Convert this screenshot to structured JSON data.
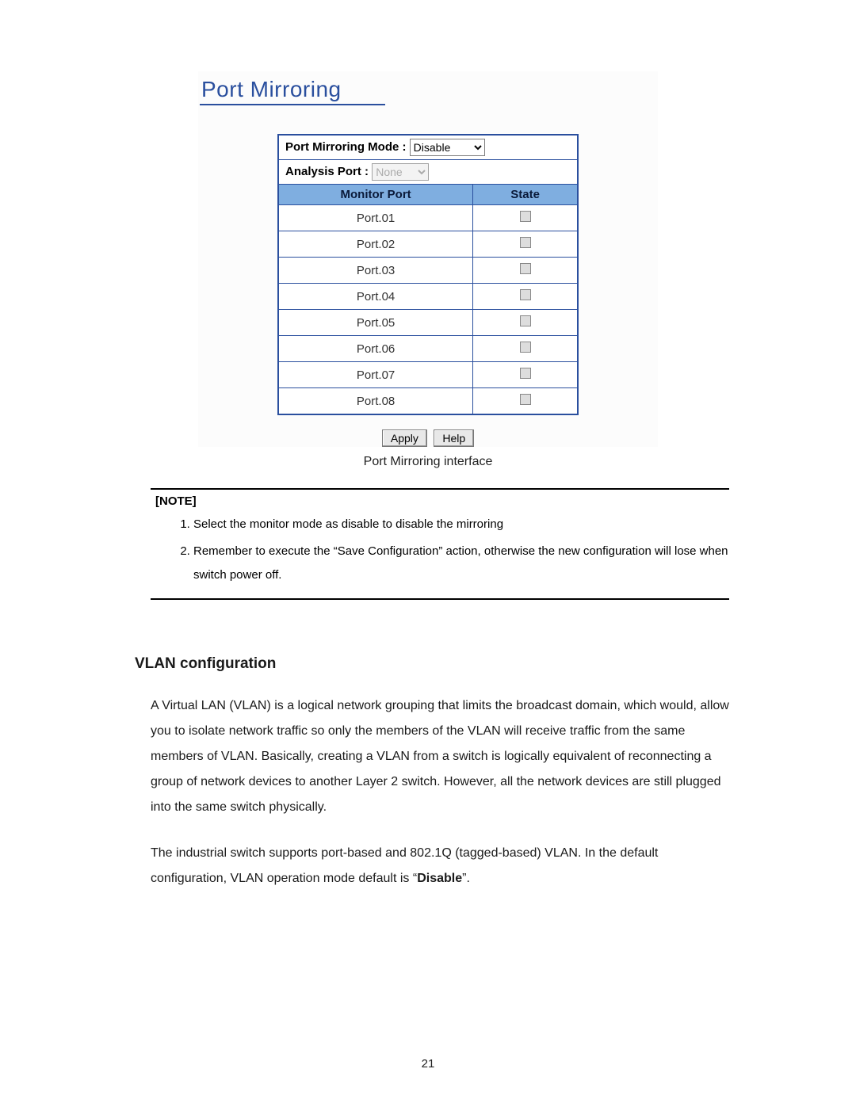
{
  "ui": {
    "title": "Port Mirroring",
    "mode_label": "Port Mirroring Mode : ",
    "mode_value": "Disable",
    "analysis_label": "Analysis Port : ",
    "analysis_value": "None",
    "col_monitor": "Monitor Port",
    "col_state": "State",
    "ports": [
      {
        "name": "Port.01",
        "checked": false
      },
      {
        "name": "Port.02",
        "checked": false
      },
      {
        "name": "Port.03",
        "checked": false
      },
      {
        "name": "Port.04",
        "checked": false
      },
      {
        "name": "Port.05",
        "checked": false
      },
      {
        "name": "Port.06",
        "checked": false
      },
      {
        "name": "Port.07",
        "checked": false
      },
      {
        "name": "Port.08",
        "checked": false
      }
    ],
    "btn_apply": "Apply",
    "btn_help": "Help"
  },
  "caption": "Port Mirroring interface",
  "note": {
    "label": "[NOTE]",
    "items": [
      "Select the monitor mode as disable to disable the mirroring",
      "Remember to execute the “Save Configuration” action, otherwise the new configuration will lose when switch power off."
    ]
  },
  "section_heading": "VLAN configuration",
  "paragraphs": {
    "p1": "A Virtual LAN (VLAN) is a logical network grouping that limits the broadcast domain, which would, allow you to isolate network traffic so only the members of the VLAN will receive traffic from the same members of VLAN. Basically, creating a VLAN from a switch is logically equivalent of reconnecting a group of network devices to another Layer 2 switch. However, all the network devices are still plugged into the same switch physically.",
    "p2_pre": "The industrial switch supports port-based and 802.1Q (tagged-based) VLAN. In the default configuration, VLAN operation mode default is “",
    "p2_bold": "Disable",
    "p2_post": "”."
  },
  "page_number": "21"
}
